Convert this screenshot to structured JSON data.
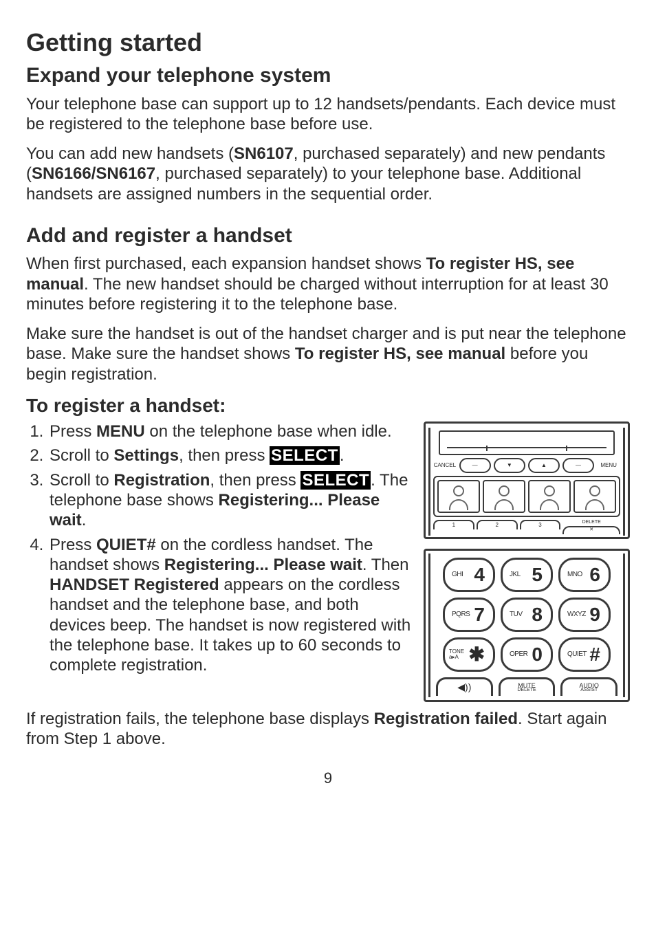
{
  "h1": "Getting started",
  "h2a": "Expand your telephone system",
  "p1_a": "Your telephone base can support up to 12 handsets/pendants. Each device must be registered to the telephone base before use.",
  "p2_a": "You can add new handsets (",
  "p2_model1": "SN6107",
  "p2_b": ", purchased separately) and new pendants (",
  "p2_model2": "SN6166/SN6167",
  "p2_c": ", purchased separately) to your telephone base. Additional handsets are assigned numbers in the sequential order.",
  "h2b": "Add and register a handset",
  "p3_a": "When first purchased, each expansion handset shows ",
  "p3_b": "To register HS, see manual",
  "p3_c": ". The new handset should be charged without interruption for at least 30 minutes before registering it to the telephone base.",
  "p4_a": "Make sure the handset is out of the handset charger and is put near the telephone base. Make sure the handset shows ",
  "p4_b": "To register HS, see manual",
  "p4_c": " before you begin registration.",
  "steps_title": "To register a handset:",
  "s1_a": "Press ",
  "s1_b": "MENU",
  "s1_c": " on the telephone base when idle.",
  "s2_a": "Scroll to ",
  "s2_b": "Settings",
  "s2_c": ", then press ",
  "s2_d": "SELECT",
  "s2_e": ".",
  "s3_a": "Scroll to ",
  "s3_b": "Registration",
  "s3_c": ", then press ",
  "s3_d": "SELECT",
  "s3_e": ". The telephone base shows ",
  "s3_f": "Registering... Please wait",
  "s3_g": ".",
  "s4_a": "Press ",
  "s4_b": "QUIET#",
  "s4_c": " on the cordless handset. The handset shows ",
  "s4_d": "Registering... Please wait",
  "s4_e": ". Then ",
  "s4_f": "HANDSET Registered",
  "s4_g": " appears on the cordless handset and the telephone base, and both devices beep. The handset is now registered with the telephone base. It takes up to 60 seconds to complete registration.",
  "p5_a": "If registration fails, the telephone base displays ",
  "p5_b": "Registration failed",
  "p5_c": ". Start again from Step 1 above.",
  "page_num": "9",
  "base": {
    "cancel": "CANCEL",
    "menu": "MENU",
    "dash": "—",
    "down": "▼",
    "up": "▲",
    "delete": "DELETE",
    "x": "✕",
    "k1": "1",
    "k2": "2",
    "k3": "3"
  },
  "keys": {
    "ghi": "GHI",
    "n4": "4",
    "jkl": "JKL",
    "n5": "5",
    "mno": "MNO",
    "n6": "6",
    "pqrs": "PQRS",
    "n7": "7",
    "tuv": "TUV",
    "n8": "8",
    "wxyz": "WXYZ",
    "n9": "9",
    "tone1": "TONE",
    "tone2": "a▸A",
    "star": "✱",
    "oper": "OPER",
    "n0": "0",
    "quiet": "QUIET",
    "hash": "#",
    "speaker": "◀))",
    "mute1": "MUTE",
    "mute2": "DELETE",
    "audio1": "AUDIO",
    "audio2": "ASSIST"
  }
}
